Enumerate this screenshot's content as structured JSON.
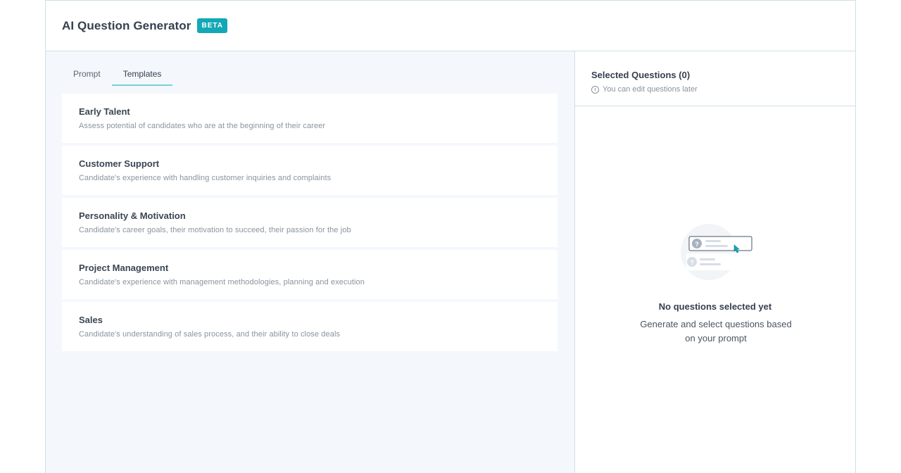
{
  "header": {
    "title": "AI Question Generator",
    "badge": "BETA"
  },
  "tabs": [
    {
      "label": "Prompt"
    },
    {
      "label": "Templates"
    }
  ],
  "templates": [
    {
      "title": "Early Talent",
      "description": "Assess potential of candidates who are at the beginning of their career"
    },
    {
      "title": "Customer Support",
      "description": "Candidate's experience with handling customer inquiries and complaints"
    },
    {
      "title": "Personality & Motivation",
      "description": "Candidate's career goals, their motivation to succeed, their passion for the job"
    },
    {
      "title": "Project Management",
      "description": "Candidate's experience with management methodologies, planning and execution"
    },
    {
      "title": "Sales",
      "description": "Candidate's understanding of sales process, and their ability to close deals"
    }
  ],
  "selected": {
    "title": "Selected Questions (0)",
    "hint": "You can edit questions later",
    "empty_title": "No questions selected yet",
    "empty_desc": "Generate and select questions based on your prompt"
  },
  "colors": {
    "accent": "#13a8b6",
    "panel_bg": "#f4f8fd",
    "border": "#cfe0e6"
  }
}
